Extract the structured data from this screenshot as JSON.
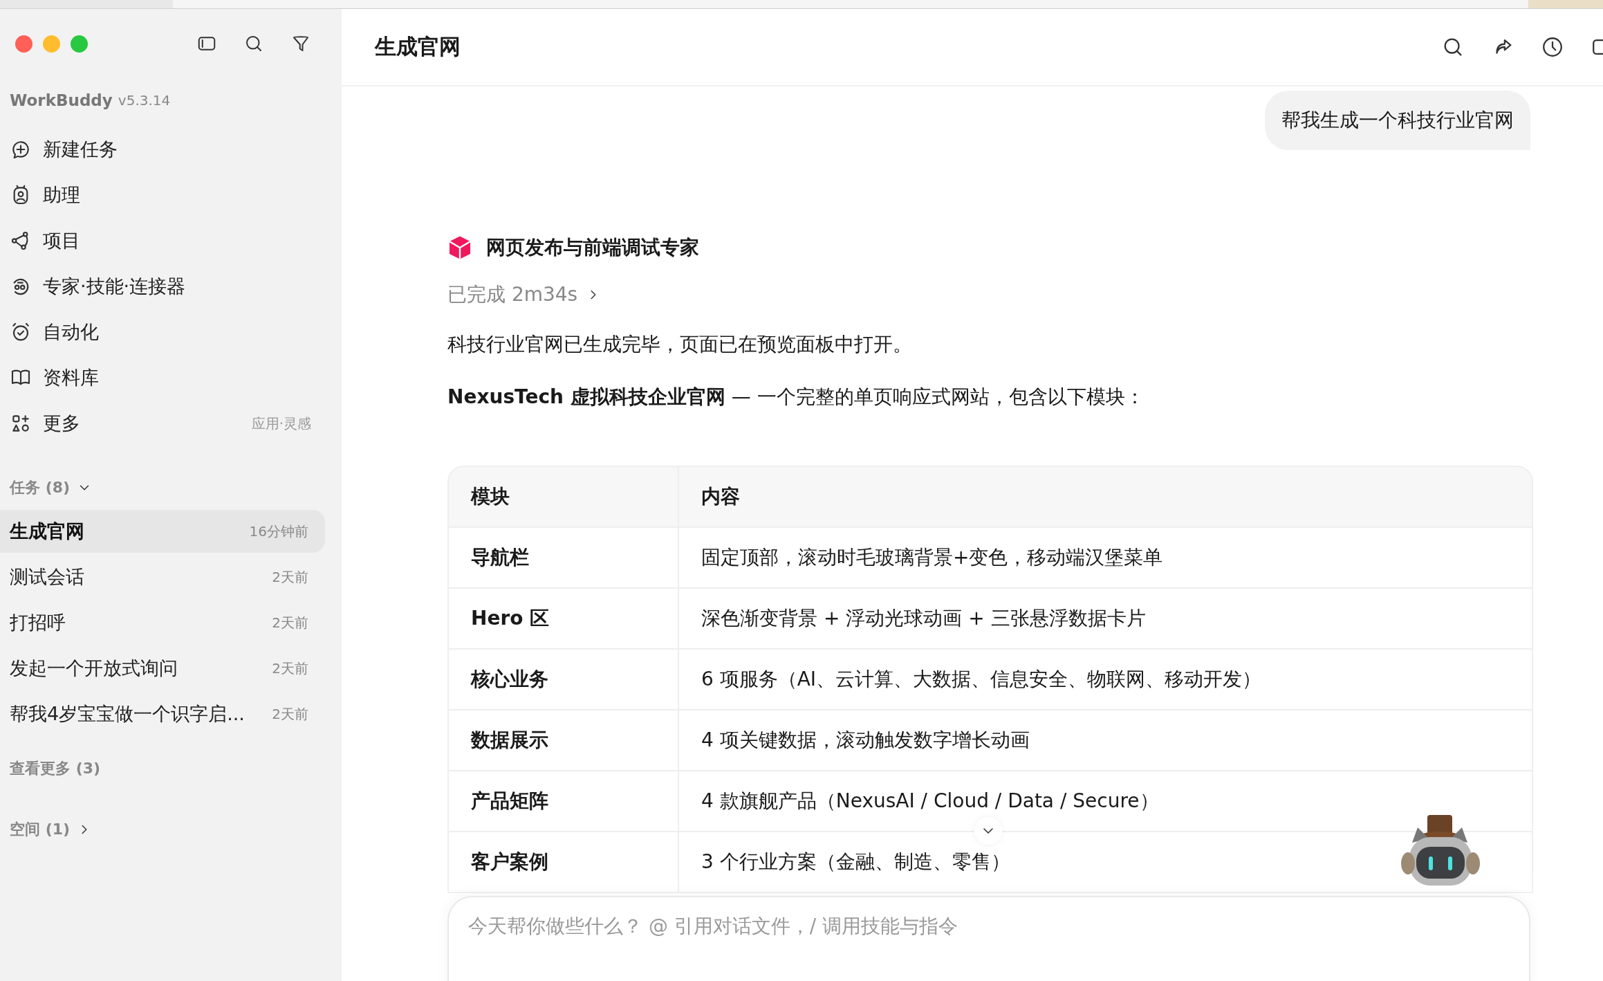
{
  "sidebar": {
    "app_name": "WorkBuddy",
    "version": "v5.3.14",
    "nav": [
      {
        "label": "新建任务",
        "kind": "new"
      },
      {
        "label": "助理",
        "kind": "assistant"
      },
      {
        "label": "项目",
        "kind": "project"
      },
      {
        "label": "专家·技能·连接器",
        "kind": "experts"
      },
      {
        "label": "自动化",
        "kind": "automation"
      },
      {
        "label": "资料库",
        "kind": "library"
      },
      {
        "label": "更多",
        "kind": "more",
        "hint": "应用·灵感"
      }
    ],
    "tasks_header": "任务 (8)",
    "tasks": [
      {
        "title": "生成官网",
        "time": "16分钟前",
        "selected": true
      },
      {
        "title": "测试会话",
        "time": "2天前",
        "selected": false
      },
      {
        "title": "打招呼",
        "time": "2天前",
        "selected": false
      },
      {
        "title": "发起一个开放式询问",
        "time": "2天前",
        "selected": false
      },
      {
        "title": "帮我4岁宝宝做一个识字启...",
        "time": "2天前",
        "selected": false
      }
    ],
    "see_more": "查看更多 (3)",
    "spaces": "空间 (1)"
  },
  "conversation": {
    "title": "生成官网",
    "user_message": "帮我生成一个科技行业官网",
    "agent_name": "网页发布与前端调试专家",
    "status": "已完成 2m34s",
    "paragraphs": [
      "科技行业官网已生成完毕，页面已在预览面板中打开。",
      "**NexusTech 虚拟科技企业官网** — 一个完整的单页响应式网站，包含以下模块："
    ],
    "table": {
      "columns": [
        "模块",
        "内容"
      ],
      "rows": [
        [
          "导航栏",
          "固定顶部，滚动时毛玻璃背景+变色，移动端汉堡菜单"
        ],
        [
          "Hero 区",
          "深色渐变背景 + 浮动光球动画 + 三张悬浮数据卡片"
        ],
        [
          "核心业务",
          "6 项服务（AI、云计算、大数据、信息安全、物联网、移动开发）"
        ],
        [
          "数据展示",
          "4 项关键数据，滚动触发数字增长动画"
        ],
        [
          "产品矩阵",
          "4 款旗舰产品（NexusAI / Cloud / Data / Secure）"
        ],
        [
          "客户案例",
          "3 个行业方案（金融、制造、零售）"
        ]
      ]
    }
  },
  "composer": {
    "placeholder": "今天帮你做些什么？ @ 引用对话文件，/ 调用技能与指令"
  }
}
